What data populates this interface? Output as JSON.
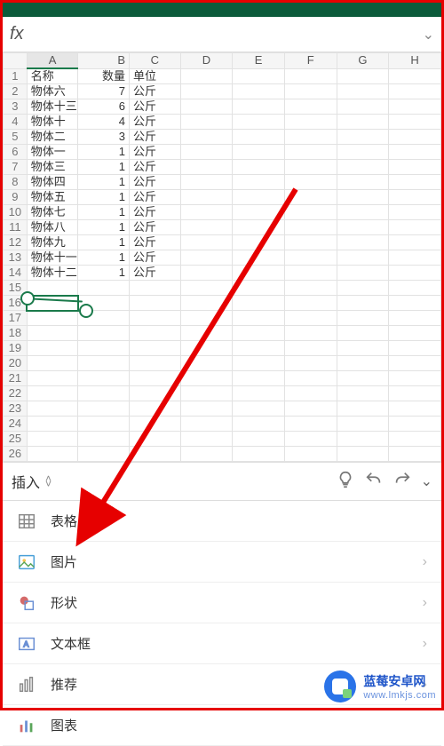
{
  "formula_bar": {
    "fx": "fx",
    "value": ""
  },
  "columns": [
    "A",
    "B",
    "C",
    "D",
    "E",
    "F",
    "G",
    "H"
  ],
  "headers": {
    "name": "名称",
    "qty": "数量",
    "unit": "单位"
  },
  "rows": [
    {
      "n": 1,
      "a": "名称",
      "b": "数量",
      "c": "单位"
    },
    {
      "n": 2,
      "a": "物体六",
      "b": 7,
      "c": "公斤"
    },
    {
      "n": 3,
      "a": "物体十三",
      "b": 6,
      "c": "公斤"
    },
    {
      "n": 4,
      "a": "物体十",
      "b": 4,
      "c": "公斤"
    },
    {
      "n": 5,
      "a": "物体二",
      "b": 3,
      "c": "公斤"
    },
    {
      "n": 6,
      "a": "物体一",
      "b": 1,
      "c": "公斤"
    },
    {
      "n": 7,
      "a": "物体三",
      "b": 1,
      "c": "公斤"
    },
    {
      "n": 8,
      "a": "物体四",
      "b": 1,
      "c": "公斤"
    },
    {
      "n": 9,
      "a": "物体五",
      "b": 1,
      "c": "公斤"
    },
    {
      "n": 10,
      "a": "物体七",
      "b": 1,
      "c": "公斤"
    },
    {
      "n": 11,
      "a": "物体八",
      "b": 1,
      "c": "公斤"
    },
    {
      "n": 12,
      "a": "物体九",
      "b": 1,
      "c": "公斤"
    },
    {
      "n": 13,
      "a": "物体十一",
      "b": 1,
      "c": "公斤"
    },
    {
      "n": 14,
      "a": "物体十二",
      "b": 1,
      "c": "公斤"
    },
    {
      "n": 15,
      "a": "",
      "b": "",
      "c": ""
    },
    {
      "n": 16,
      "a": "",
      "b": "",
      "c": ""
    },
    {
      "n": 17,
      "a": "",
      "b": "",
      "c": ""
    },
    {
      "n": 18,
      "a": "",
      "b": "",
      "c": ""
    },
    {
      "n": 19,
      "a": "",
      "b": "",
      "c": ""
    },
    {
      "n": 20,
      "a": "",
      "b": "",
      "c": ""
    },
    {
      "n": 21,
      "a": "",
      "b": "",
      "c": ""
    },
    {
      "n": 22,
      "a": "",
      "b": "",
      "c": ""
    },
    {
      "n": 23,
      "a": "",
      "b": "",
      "c": ""
    },
    {
      "n": 24,
      "a": "",
      "b": "",
      "c": ""
    },
    {
      "n": 25,
      "a": "",
      "b": "",
      "c": ""
    },
    {
      "n": 26,
      "a": "",
      "b": "",
      "c": ""
    }
  ],
  "selected": {
    "col": "A",
    "row": 16
  },
  "ribbon": {
    "tab": "插入",
    "icons": {
      "tips": "lightbulb",
      "undo": "undo",
      "redo": "redo",
      "more": "chevron-down"
    }
  },
  "menu": [
    {
      "key": "table",
      "label": "表格",
      "chevron": false
    },
    {
      "key": "picture",
      "label": "图片",
      "chevron": true
    },
    {
      "key": "shape",
      "label": "形状",
      "chevron": true
    },
    {
      "key": "textbox",
      "label": "文本框",
      "chevron": true
    },
    {
      "key": "recommended",
      "label": "推荐",
      "chevron": true
    },
    {
      "key": "chart",
      "label": "图表",
      "chevron": false
    }
  ],
  "watermark": {
    "name": "蓝莓安卓网",
    "url": "www.lmkjs.com"
  },
  "colors": {
    "accent": "#1a7a4b",
    "annotation": "#e60000",
    "brand": "#2a73e8"
  }
}
